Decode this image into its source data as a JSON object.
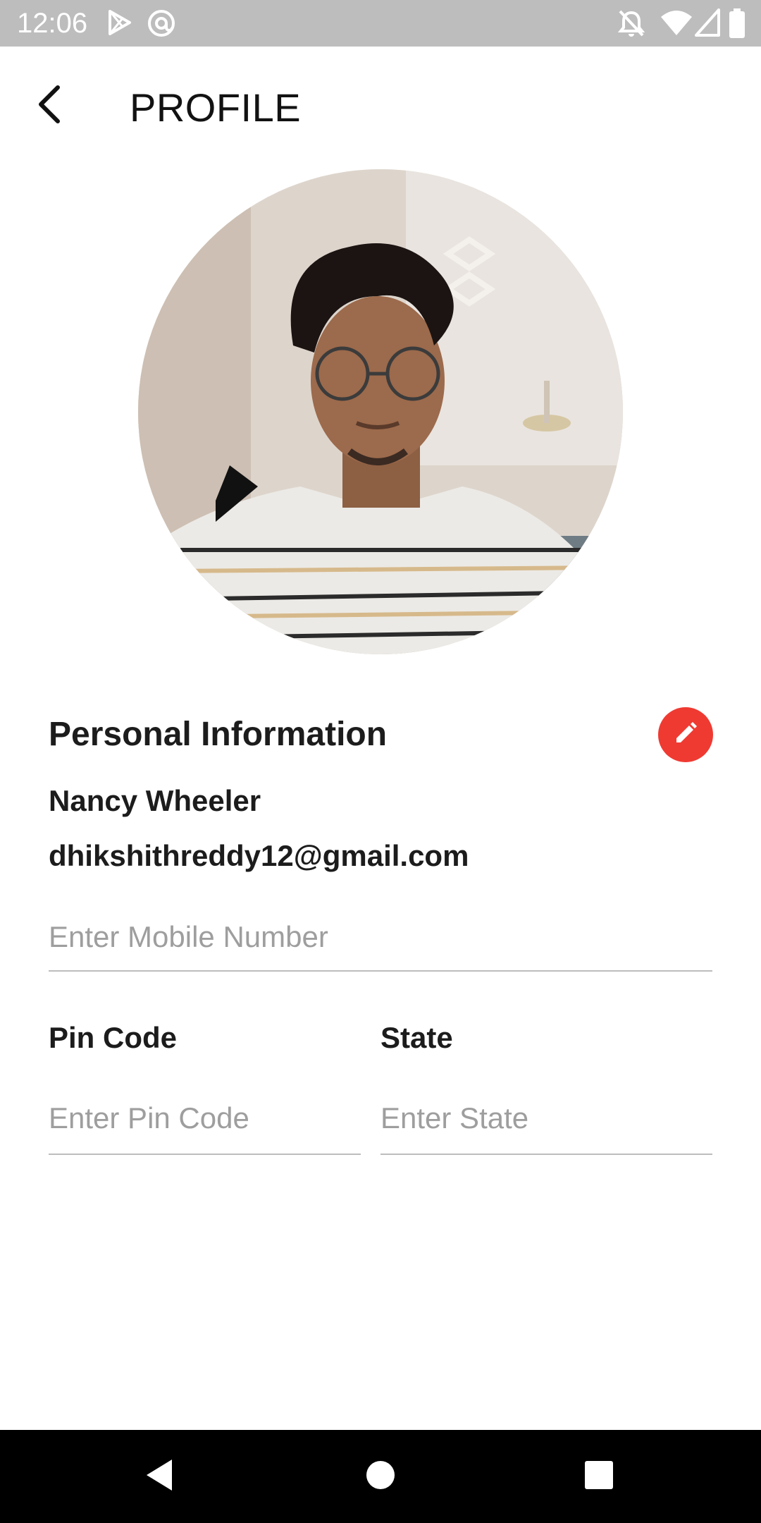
{
  "status_bar": {
    "time": "12:06",
    "left_icons": [
      "play-store-icon",
      "at-sign-icon"
    ],
    "right_icons": [
      "notifications-off-icon",
      "wifi-icon",
      "cellular-signal-icon",
      "battery-icon"
    ]
  },
  "header": {
    "back_icon": "chevron-left-icon",
    "title": "PROFILE"
  },
  "avatar": {
    "description": "profile-photo"
  },
  "personal_info": {
    "title": "Personal Information",
    "edit_icon": "pencil-icon",
    "edit_color": "#ef3a32",
    "name": "Nancy Wheeler",
    "email": "dhikshithreddy12@gmail.com",
    "mobile_placeholder": "Enter Mobile Number",
    "mobile_value": ""
  },
  "address": {
    "pin_label": "Pin Code",
    "pin_placeholder": "Enter Pin Code",
    "pin_value": "",
    "state_label": "State",
    "state_placeholder": "Enter State",
    "state_value": ""
  },
  "nav_bar": {
    "icons": [
      "back-triangle-icon",
      "home-circle-icon",
      "recents-square-icon"
    ]
  }
}
